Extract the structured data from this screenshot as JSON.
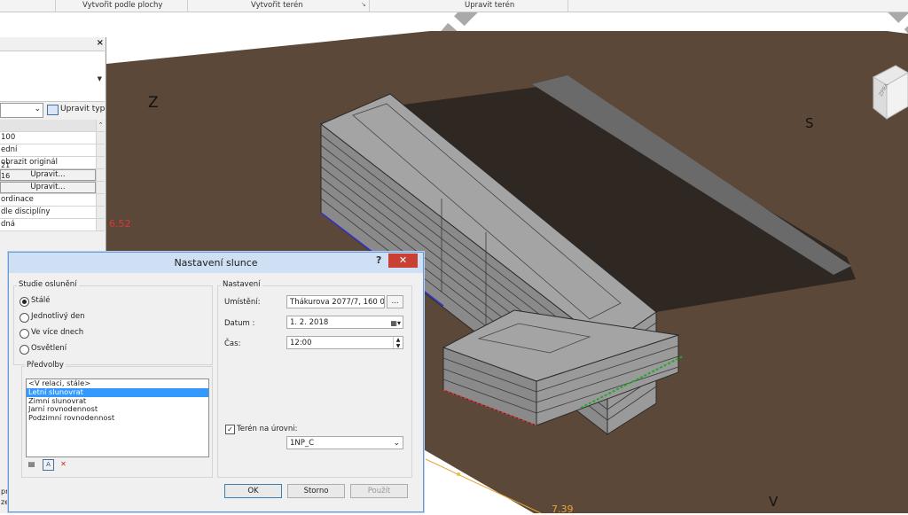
{
  "ribbon": {
    "items": [
      "Vytvořit podle plochy",
      "Vytvořit terén",
      "Upravit terén"
    ]
  },
  "viewport": {
    "compass": {
      "north": "S",
      "south": "Z",
      "east": "V"
    },
    "elevation_left": "6.52",
    "elevation_bottom": "7.39",
    "viewcube_face": "ZPRA"
  },
  "properties": {
    "close": "×",
    "edit_type": "Upravit typ",
    "rows": [
      "100",
      "ední",
      "obrazit originál",
      "Upravit...",
      "Upravit...",
      "ordinace",
      "dle disciplíny",
      "dná"
    ],
    "lower": [
      "21",
      "16",
      "pr",
      "ze"
    ]
  },
  "dialog": {
    "title": "Nastavení slunce",
    "help": "?",
    "close": "✕",
    "study_group": "Studie oslunění",
    "study_options": [
      "Stálé",
      "Jednotlivý den",
      "Ve více dnech",
      "Osvětlení"
    ],
    "study_selected": 0,
    "presets_group": "Předvolby",
    "presets": [
      "<V relaci, stále>",
      "Letní slunovrat",
      "Zimní slunovrat",
      "Jarní rovnodennost",
      "Podzimní rovnodennost"
    ],
    "preset_selected": 1,
    "settings_group": "Nastavení",
    "location_label": "Umístění:",
    "location_value": "Thákurova 2077/7, 160 00 Pr",
    "browse": "...",
    "date_label": "Datum :",
    "date_value": "1.   2. 2018",
    "time_label": "Čas:",
    "time_value": "12:00",
    "terrain_label": "Terén na úrovni:",
    "terrain_checked": true,
    "level_value": "1NP_C",
    "buttons": {
      "ok": "OK",
      "cancel": "Storno",
      "apply": "Použít"
    }
  },
  "colors": {
    "ground": "#5c4838",
    "shadow": "#2f2721",
    "building": "#8c8c8c",
    "accent": "#3399ff",
    "elevation": "#d23b3b"
  }
}
